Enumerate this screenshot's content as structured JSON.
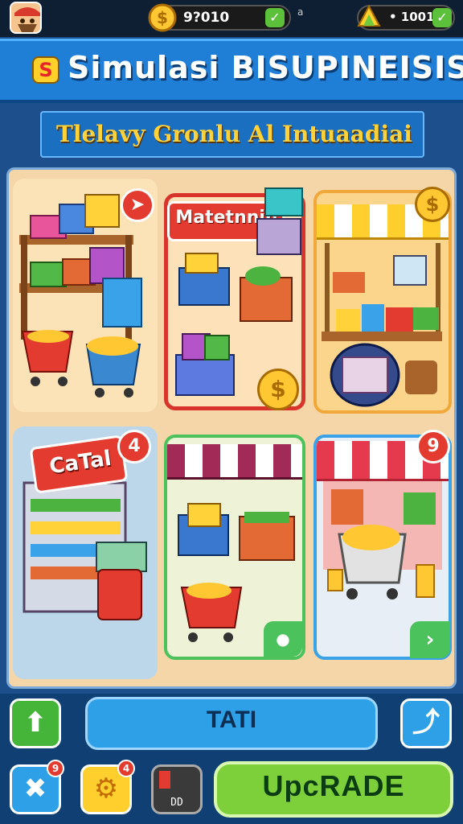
{
  "hud": {
    "coins": "9?010",
    "coin_icon": "dollar-coin-icon",
    "separator": "a",
    "gems": "• 1001",
    "gem_icon": "gem-stack-icon"
  },
  "title": {
    "badge": "S",
    "text": "Simulasi BISUPINEISIS"
  },
  "subtitle": "Tlelavy Gronlu Al Intuaadiai",
  "cards": {
    "shelf": {
      "badge_icon": "arrow-right-icon"
    },
    "materials": {
      "label": "Matetnnin",
      "coin_badge": "$"
    },
    "stall": {
      "coin_badge": "$"
    },
    "cart": {
      "label": "CaTal",
      "badge": "4"
    },
    "market": {
      "action_icon": "play-icon"
    },
    "shop": {
      "badge": "9",
      "action_icon": "chevron-right-icon"
    }
  },
  "controls": {
    "up_icon": "up-arrow-icon",
    "start_label": "TATI",
    "share_icon": "share-icon",
    "tools_badge": "9",
    "settings_badge": "4",
    "slot_label": "DD",
    "upgrade_label": "UpcRADE"
  },
  "colors": {
    "accent_blue": "#1f7fd6",
    "accent_red": "#e33b2f",
    "accent_green": "#7ed03a",
    "accent_yellow": "#ffd23a"
  }
}
